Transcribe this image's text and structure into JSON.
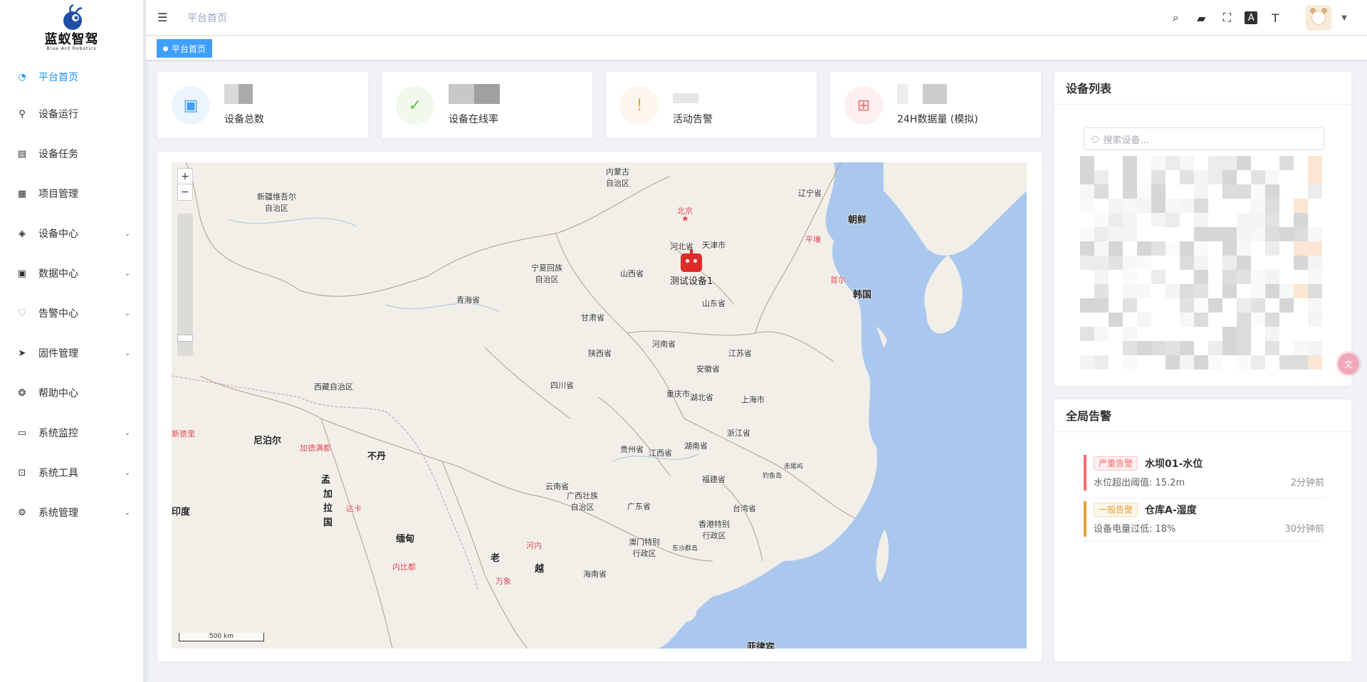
{
  "app": {
    "logo_name": "蓝蚁智驾",
    "logo_sub": "Blue Ant Robotics"
  },
  "sidebar": {
    "items": [
      {
        "label": "平台首页",
        "icon": "dashboard-icon",
        "active": true,
        "expandable": false
      },
      {
        "label": "设备运行",
        "icon": "run-icon",
        "active": false,
        "expandable": false
      },
      {
        "label": "设备任务",
        "icon": "task-icon",
        "active": false,
        "expandable": false
      },
      {
        "label": "项目管理",
        "icon": "grid-icon",
        "active": false,
        "expandable": false
      },
      {
        "label": "设备中心",
        "icon": "cube-icon",
        "active": false,
        "expandable": true
      },
      {
        "label": "数据中心",
        "icon": "document-icon",
        "active": false,
        "expandable": true
      },
      {
        "label": "告警中心",
        "icon": "shield-icon",
        "active": false,
        "expandable": true
      },
      {
        "label": "固件管理",
        "icon": "send-icon",
        "active": false,
        "expandable": true
      },
      {
        "label": "帮助中心",
        "icon": "help-icon",
        "active": false,
        "expandable": false
      },
      {
        "label": "系统监控",
        "icon": "monitor-icon",
        "active": false,
        "expandable": true
      },
      {
        "label": "系统工具",
        "icon": "toolbox-icon",
        "active": false,
        "expandable": true
      },
      {
        "label": "系统管理",
        "icon": "gear-icon",
        "active": false,
        "expandable": true
      }
    ]
  },
  "header": {
    "breadcrumb": "平台首页",
    "icons": [
      "search-icon",
      "chat-icon",
      "fullscreen-icon",
      "translate-icon",
      "font-size-icon"
    ]
  },
  "tags": {
    "active_tag": "平台首页"
  },
  "stats": [
    {
      "label": "设备总数",
      "icon": "chip-icon",
      "color": "#409eff",
      "bg": "#ecf5ff"
    },
    {
      "label": "设备在线率",
      "icon": "check-circle-icon",
      "color": "#67c23a",
      "bg": "#f0f9eb"
    },
    {
      "label": "活动告警",
      "icon": "warning-icon",
      "color": "#e6a23c",
      "bg": "#fdf6ec"
    },
    {
      "label": "24H数据量 (模拟)",
      "icon": "presentation-icon",
      "color": "#f56c6c",
      "bg": "#fef0f0"
    }
  ],
  "map": {
    "scale_label": "500 km",
    "device_name": "测试设备1",
    "labels": {
      "neimenggu": "内蒙古\n自治区",
      "xinjiang": "新疆维吾尔\n自治区",
      "beijing": "北京",
      "liaoning": "辽宁省",
      "chaoxian": "朝鲜",
      "pingrang": "平壤",
      "hebei": "河北省",
      "tianjin": "天津市",
      "ningxia": "宁夏回族\n自治区",
      "shanxi": "山西省",
      "shouer": "首尔",
      "hanguo": "韩国",
      "qinghai": "青海省",
      "shandong": "山东省",
      "gansu": "甘肃省",
      "henan": "河南省",
      "shaanxi": "陕西省",
      "jiangsu": "江苏省",
      "anhui": "安徽省",
      "xizang": "西藏自治区",
      "sichuan": "四川省",
      "chongqing": "重庆市",
      "hubei": "湖北省",
      "shanghai": "上海市",
      "nepal": "尼泊尔",
      "kathmandu": "加德满都",
      "newdelhi": "新德里",
      "bhutan": "不丹",
      "zhejiang": "浙江省",
      "hunan": "湖南省",
      "jiangxi": "江西省",
      "guizhou": "贵州省",
      "chiweiyu": "赤尾屿",
      "diaoyudao": "钓鱼岛",
      "fujian": "福建省",
      "bangla1": "孟",
      "bangla2": "加",
      "bangla3": "拉",
      "bangla4": "国",
      "dhaka": "达卡",
      "yunnan": "云南省",
      "india": "印度",
      "guangxi": "广西壮族\n自治区",
      "guangdong": "广东省",
      "taiwan": "台湾省",
      "hongkong": "香港特别\n行政区",
      "myanmar": "缅甸",
      "hanoi": "河内",
      "macau": "澳门特别\n行政区",
      "dongsha": "东沙群岛",
      "naypyidaw": "内比都",
      "laos": "老",
      "vietnam": "越",
      "hainan": "海南省",
      "vientiane": "万象",
      "philippines": "菲律宾"
    }
  },
  "device_list": {
    "title": "设备列表",
    "search_placeholder": "搜索设备..."
  },
  "alerts": {
    "title": "全局告警",
    "items": [
      {
        "level": "严重告警",
        "title": "水坝01-水位",
        "desc": "水位超出阈值: 15.2m",
        "time": "2分钟前",
        "color": "#f56c6c"
      },
      {
        "level": "一般告警",
        "title": "仓库A-湿度",
        "desc": "设备电量过低: 18%",
        "time": "30分钟前",
        "color": "#e6a23c"
      }
    ]
  }
}
